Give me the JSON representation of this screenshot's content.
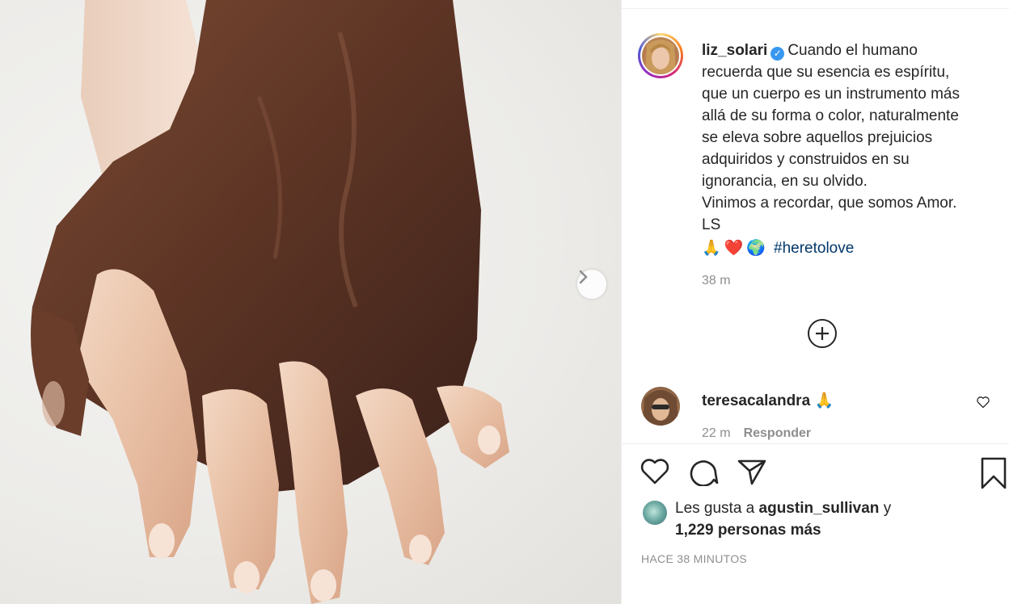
{
  "post": {
    "username": "liz_solari",
    "caption_lines": [
      "Cuando el humano",
      "recuerda que su esencia es espíritu,",
      "que un cuerpo es un instrumento más",
      "allá de su forma o color, naturalmente",
      "se eleva sobre aquellos prejuicios",
      "adquiridos y construidos en su",
      "ignorancia, en su olvido.",
      "Vinimos a recordar, que somos Amor.",
      "LS"
    ],
    "emojis": [
      "🙏",
      "❤️",
      "🌍"
    ],
    "hashtag": "#heretolove",
    "time": "38 m"
  },
  "comment": {
    "username": "teresacalandra",
    "emoji": "🙏",
    "time": "22 m",
    "reply_label": "Responder"
  },
  "likes": {
    "prefix": "Les gusta a",
    "user": "agustin_sullivan",
    "connector": "y",
    "count_text": "1,229 personas más"
  },
  "post_time": "HACE 38 MINUTOS",
  "icons": {
    "verified": "verified-badge-icon",
    "next": "chevron-right-icon",
    "load_more": "plus-circle-icon",
    "like": "heart-icon",
    "comment": "comment-bubble-icon",
    "share": "paper-plane-icon",
    "save": "bookmark-icon"
  },
  "colors": {
    "text": "#262626",
    "muted": "#8e8e8e",
    "hashtag": "#00376b",
    "verified": "#3897f0",
    "divider": "#efefef"
  }
}
